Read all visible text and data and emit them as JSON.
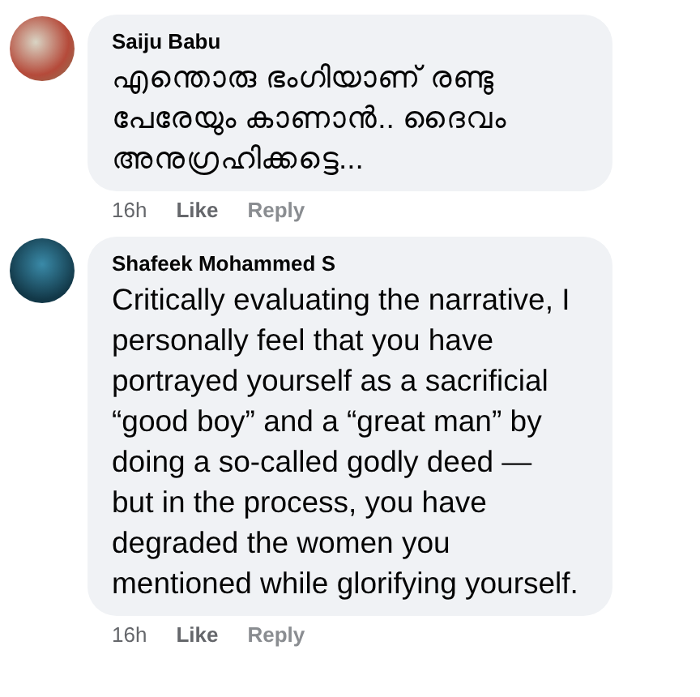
{
  "comments": [
    {
      "author": "Saiju Babu",
      "text": "എന്തൊരു ഭംഗിയാണ് രണ്ടു പേരേയും കാണാൻ.. ദൈവം അനുഗ്രഹിക്കട്ടെ...",
      "time": "16h",
      "like": "Like",
      "reply": "Reply"
    },
    {
      "author": "Shafeek Mohammed S",
      "text": "Critically evaluating the narrative, I personally feel that you have portrayed yourself as a sacrificial “good boy” and a “great man” by doing a so-called godly deed — but in the process, you have degraded the women you mentioned while glorifying yourself.",
      "time": "16h",
      "like": "Like",
      "reply": "Reply"
    }
  ]
}
